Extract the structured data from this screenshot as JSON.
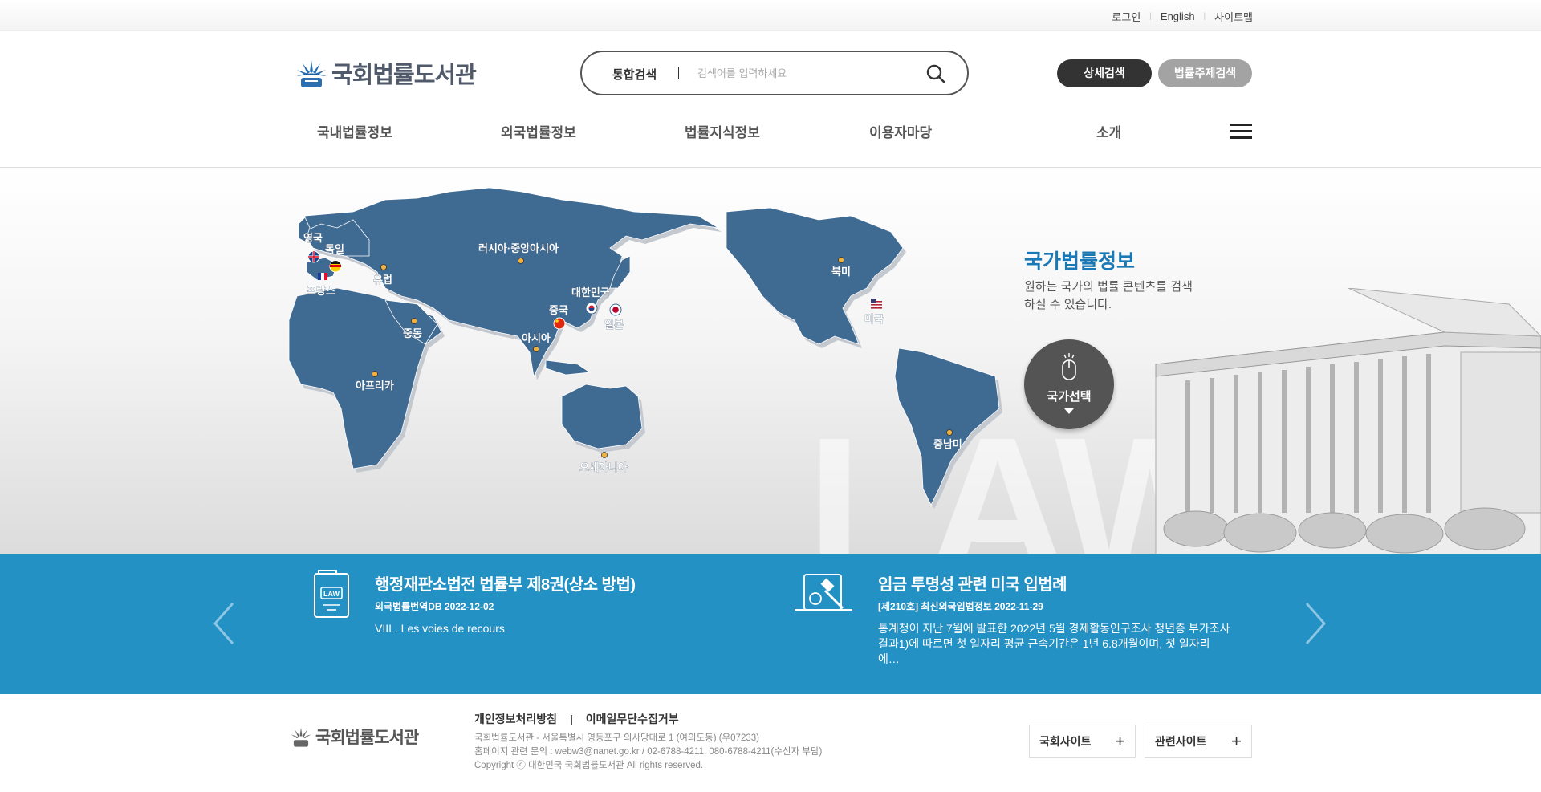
{
  "util_nav": {
    "login": "로그인",
    "english": "English",
    "sitemap": "사이트맵"
  },
  "header": {
    "logo_text": "국회법률도서관",
    "search": {
      "scope": "통합검색",
      "placeholder": "검색어를 입력하세요"
    },
    "detail_search": "상세검색",
    "topic_search": "법률주제검색"
  },
  "gnb": {
    "items": [
      "국내법률정보",
      "외국법률정보",
      "법률지식정보",
      "이용자마당",
      "소개"
    ]
  },
  "hero": {
    "watermark": "LAW",
    "title": "국가법률정보",
    "desc": "원하는 국가의 법률 콘텐츠를 검색하실 수 있습니다.",
    "select_label": "국가선택",
    "regions": [
      "영국",
      "독일",
      "프랑스",
      "유럽",
      "러시아·중앙아시아",
      "대한민국",
      "중국",
      "일본",
      "중동",
      "아시아",
      "아프리카",
      "오세아니아",
      "북미",
      "미국",
      "중남미"
    ]
  },
  "news": [
    {
      "title": "행정재판소법전 법률부 제8권(상소 방법)",
      "meta": "외국법률번역DB 2022-12-02",
      "body": "VIII . Les voies de recours"
    },
    {
      "title": "임금 투명성 관련 미국 입법례",
      "meta": "[제210호] 최신외국입법정보 2022-11-29",
      "body": "통계청이 지난 7월에 발표한 2022년 5월 경제활동인구조사 청년층 부가조사 결과1)에 따르면 첫 일자리 평균 근속기간은 1년 6.8개월이며, 첫 일자리에…"
    }
  ],
  "footer": {
    "logo_text": "국회법률도서관",
    "privacy": "개인정보처리방침",
    "email_refuse": "이메일무단수집거부",
    "address": "국회법률도서관 - 서울특별시 영등포구 의사당대로 1 (여의도동) (우07233)",
    "contact": "홈페이지 관련 문의 : webw3@nanet.go.kr / 02-6788-4211, 080-6788-4211(수신자 부담)",
    "copyright": "Copyright ⓒ 대한민국 국회법률도서관 All rights reserved.",
    "assembly_sites": "국회사이트",
    "related_sites": "관련사이트"
  },
  "colors": {
    "accent": "#2491c5",
    "map": "#3f6a92",
    "title": "#1a78b4"
  }
}
